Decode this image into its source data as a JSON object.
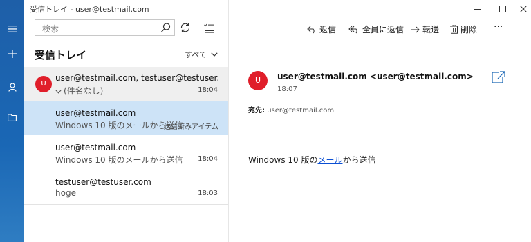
{
  "window": {
    "title": "受信トレイ - user@testmail.com"
  },
  "rail": {
    "icons": [
      "hamburger-icon",
      "plus-icon",
      "person-icon",
      "folder-icon"
    ]
  },
  "search": {
    "placeholder": "検索"
  },
  "folder": {
    "title": "受信トレイ",
    "filter_label": "すべて"
  },
  "messages": [
    {
      "avatar": "U",
      "sender": "user@testmail.com, testuser@testuser.cc",
      "subject": "(件名なし)",
      "time": "18:04"
    },
    {
      "sender": "user@testmail.com",
      "subject": "Windows 10 版のメールから送信",
      "time": "送信済みアイテム"
    },
    {
      "sender": "user@testmail.com",
      "subject": "Windows 10 版のメールから送信",
      "time": "18:04"
    },
    {
      "sender": "testuser@testuser.com",
      "subject": "hoge",
      "time": "18:03"
    }
  ],
  "toolbar": {
    "reply": "返信",
    "reply_all": "全員に返信",
    "forward": "転送",
    "delete": "削除",
    "more": "···"
  },
  "reading": {
    "avatar": "U",
    "from": "user@testmail.com <user@testmail.com>",
    "time": "18:07",
    "to_label": "宛先:",
    "to_value": "user@testmail.com",
    "body_prefix": "Windows 10 版の",
    "body_link": "メール",
    "body_suffix": "から送信"
  },
  "colors": {
    "accent": "#1a67b5",
    "avatar": "#e01e2a",
    "selected_item": "#cde3f7",
    "link": "#0b4fd3"
  }
}
